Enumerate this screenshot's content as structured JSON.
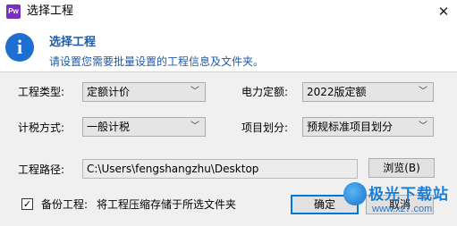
{
  "window": {
    "title": "选择工程",
    "app_icon_text": "Pw",
    "close_glyph": "✕"
  },
  "banner": {
    "icon_text": "i",
    "title": "选择工程",
    "description": "请设置您需要批量设置的工程信息及文件夹。"
  },
  "form": {
    "project_type": {
      "label": "工程类型:",
      "value": "定额计价"
    },
    "power_quota": {
      "label": "电力定额:",
      "value": "2022版定额"
    },
    "tax_method": {
      "label": "计税方式:",
      "value": "一般计税"
    },
    "item_division": {
      "label": "项目划分:",
      "value": "预规标准项目划分"
    },
    "project_path": {
      "label": "工程路径:",
      "value": "C:\\Users\\fengshangzhu\\Desktop"
    },
    "browse_label": "浏览(B)",
    "dropdown_arrow": "﹀"
  },
  "footer": {
    "backup_checked": true,
    "backup_check_glyph": "✓",
    "backup_label": "备份工程:",
    "backup_desc": "将工程压缩存储于所选文件夹",
    "ok_label": "确定",
    "cancel_label": "取消"
  },
  "watermark": {
    "title": "极光下载站",
    "url": "www.xz7.com"
  },
  "colors": {
    "accent_blue": "#1e5aa8",
    "info_icon": "#1f6fd1",
    "app_icon": "#7a2fbf",
    "default_button_border": "#0078d7"
  }
}
